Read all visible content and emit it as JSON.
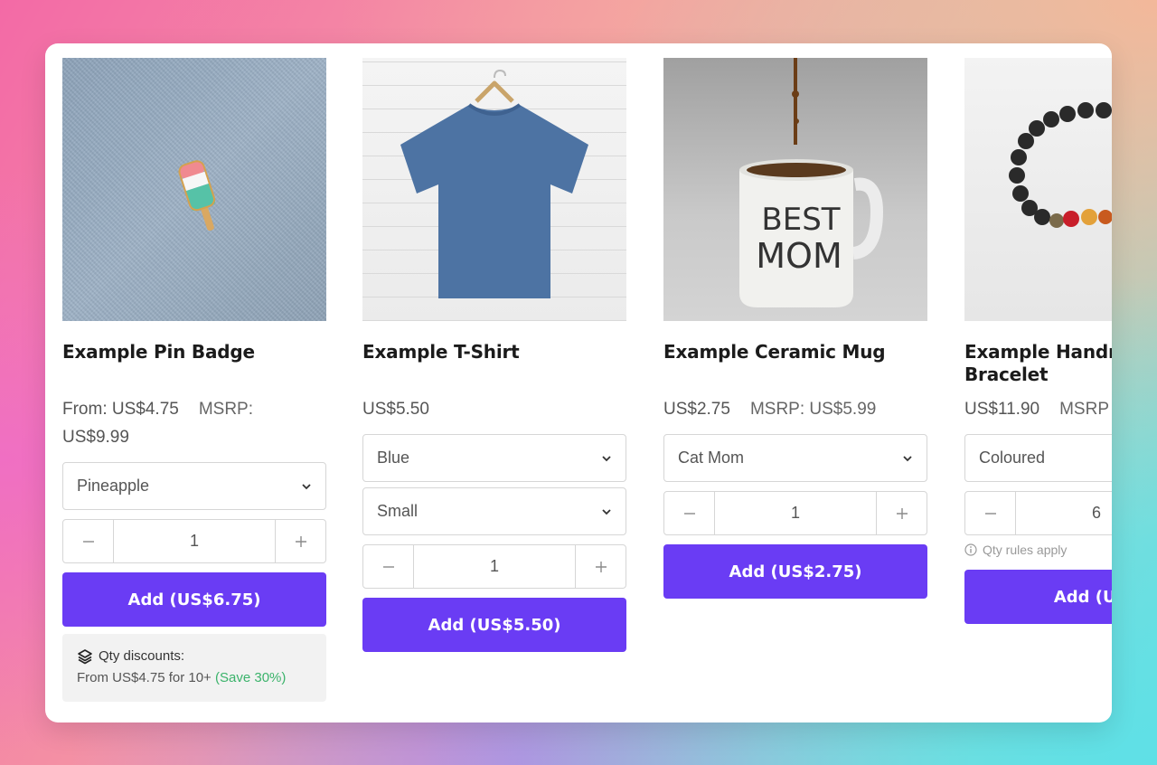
{
  "colors": {
    "accent": "#6a3cf4",
    "save_green": "#3bb36b"
  },
  "products": [
    {
      "title": "Example Pin Badge",
      "price_line1": "From: US$4.75",
      "msrp_label": "MSRP:",
      "price_line2": "US$9.99",
      "select1": "Pineapple",
      "qty": "1",
      "add_label": "Add (US$6.75)",
      "discount_title": "Qty discounts:",
      "discount_text": "From US$4.75 for 10+",
      "discount_save": "(Save 30%)"
    },
    {
      "title": "Example T-Shirt",
      "price": "US$5.50",
      "select1": "Blue",
      "select2": "Small",
      "qty": "1",
      "add_label": "Add (US$5.50)"
    },
    {
      "title": "Example Ceramic Mug",
      "price": "US$2.75",
      "msrp": "MSRP: US$5.99",
      "mug_text_1": "BEST",
      "mug_text_2": "MOM",
      "select1": "Cat Mom",
      "qty": "1",
      "add_label": "Add (US$2.75)"
    },
    {
      "title_line1": "Example Handr",
      "title_line2": "Bracelet",
      "price": "US$11.90",
      "msrp": "MSRP",
      "select1": "Coloured",
      "qty": "6",
      "rules": "Qty rules apply",
      "add_label": "Add (US$"
    }
  ],
  "icons": {
    "chevron": "chevron-down-icon",
    "minus": "minus-icon",
    "plus": "plus-icon",
    "layers": "layers-icon",
    "info": "info-icon"
  }
}
